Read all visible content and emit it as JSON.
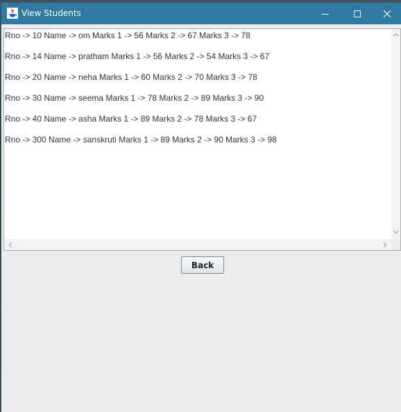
{
  "window": {
    "title": "View Students",
    "controls": {
      "minimize": "minimize-icon",
      "maximize": "maximize-icon",
      "close": "close-icon"
    }
  },
  "students": [
    {
      "text": "Rno -> 10 Name -> om Marks 1 -> 56 Marks 2 -> 67 Marks 3 -> 78"
    },
    {
      "text": "Rno -> 14 Name -> pratham Marks 1 -> 56 Marks 2 -> 54 Marks 3 -> 67"
    },
    {
      "text": "Rno -> 20 Name -> neha Marks 1 -> 60 Marks 2 -> 70 Marks 3 -> 78"
    },
    {
      "text": "Rno -> 30 Name -> seema Marks 1 -> 78 Marks 2 -> 89 Marks 3 -> 90"
    },
    {
      "text": "Rno -> 40 Name -> asha Marks 1 -> 89 Marks 2 -> 78 Marks 3 -> 67"
    },
    {
      "text": "Rno -> 300 Name -> sanskruti Marks 1 -> 89 Marks 2 -> 90 Marks 3 -> 98"
    }
  ],
  "buttons": {
    "back": "Back"
  },
  "colors": {
    "titlebar": "#2f7aa0",
    "background": "#ececec",
    "text": "#333333"
  }
}
